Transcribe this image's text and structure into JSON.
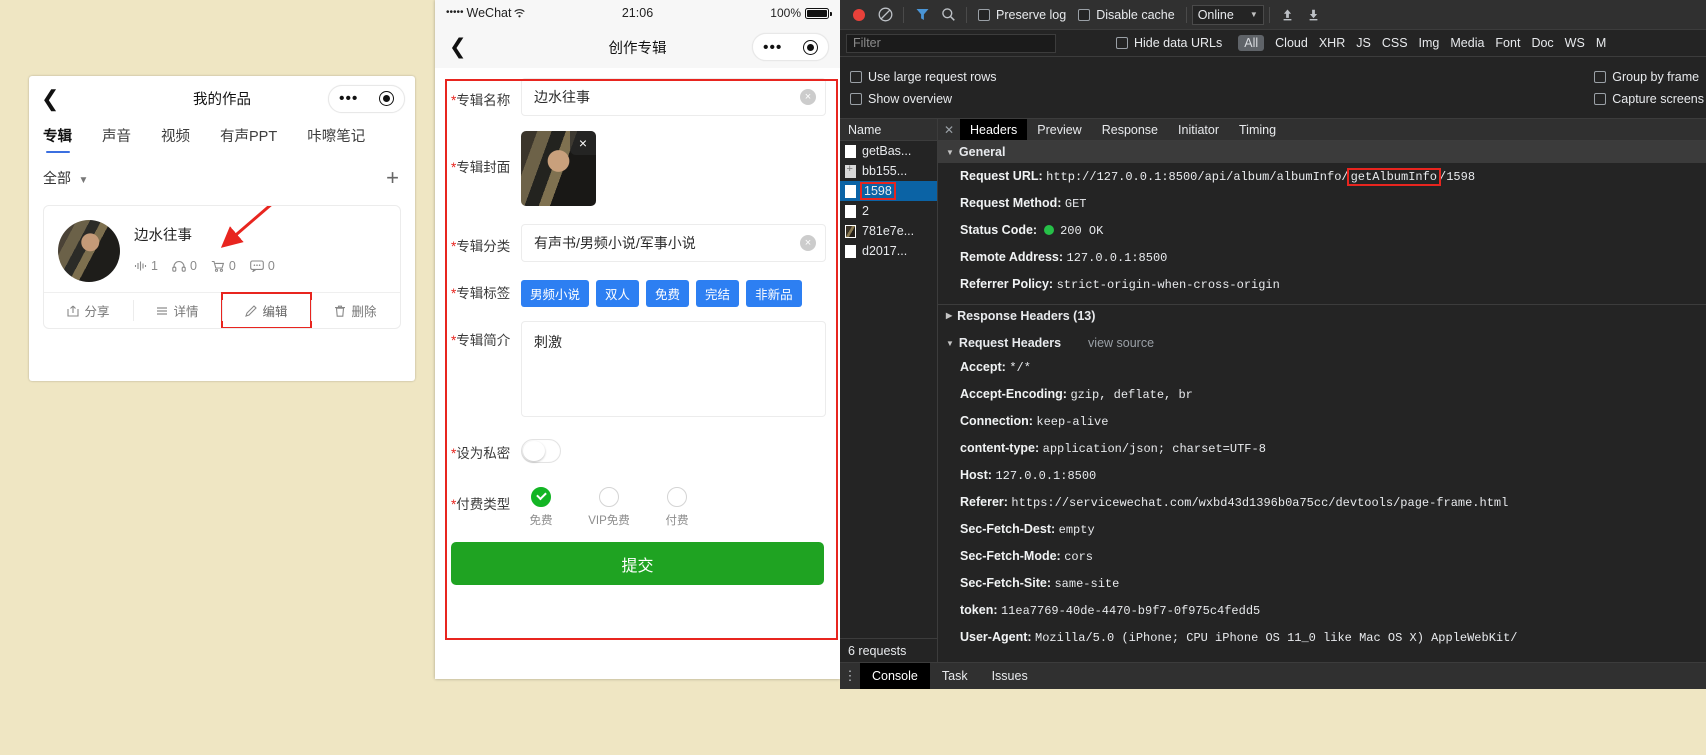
{
  "left_panel": {
    "nav": {
      "back_icon": "chevron-left-icon",
      "title": "我的作品",
      "capsule_dots": "•••",
      "capsule_circle": "target-icon"
    },
    "tabs": [
      {
        "label": "专辑",
        "active": true
      },
      {
        "label": "声音",
        "active": false
      },
      {
        "label": "视频",
        "active": false
      },
      {
        "label": "有声PPT",
        "active": false
      },
      {
        "label": "咔嚓笔记",
        "active": false
      }
    ],
    "filter": {
      "label": "全部",
      "chevron": "chevron-down-icon",
      "add": "+"
    },
    "card": {
      "title": "边水往事",
      "stats": [
        {
          "icon": "sound-wave-icon",
          "value": "1"
        },
        {
          "icon": "headphone-icon",
          "value": "0"
        },
        {
          "icon": "cart-icon",
          "value": "0"
        },
        {
          "icon": "comment-icon",
          "value": "0"
        }
      ],
      "actions": [
        {
          "icon": "share-icon",
          "label": "分享",
          "highlight": false
        },
        {
          "icon": "list-icon",
          "label": "详情",
          "highlight": false
        },
        {
          "icon": "pencil-icon",
          "label": "编辑",
          "highlight": true
        },
        {
          "icon": "trash-icon",
          "label": "删除",
          "highlight": false
        }
      ]
    }
  },
  "mid_phone": {
    "status": {
      "carrier": "WeChat",
      "signal_dots": "•••••",
      "wifi": "wifi-icon",
      "time": "21:06",
      "battery": "100%"
    },
    "nav": {
      "back_icon": "chevron-left-icon",
      "title": "创作专辑",
      "capsule_dots": "•••",
      "capsule_circle": "target-icon"
    },
    "form": {
      "name": {
        "label": "专辑名称",
        "value": "边水往事",
        "clear": "×"
      },
      "cover": {
        "label": "专辑封面",
        "remove": "×"
      },
      "category": {
        "label": "专辑分类",
        "value": "有声书/男频小说/军事小说",
        "clear": "×"
      },
      "tags": {
        "label": "专辑标签",
        "items": [
          "男频小说",
          "双人",
          "免费",
          "完结",
          "非新品"
        ]
      },
      "intro": {
        "label": "专辑简介",
        "value": "刺激"
      },
      "private": {
        "label": "设为私密",
        "on": false
      },
      "pay": {
        "label": "付费类型",
        "options": [
          {
            "label": "免费",
            "selected": true
          },
          {
            "label": "VIP免费",
            "selected": false
          },
          {
            "label": "付费",
            "selected": false
          }
        ]
      },
      "submit_label": "提交"
    }
  },
  "devtools": {
    "toolbar": {
      "record_icon": "record-dot-icon",
      "clear_icon": "clear-circle-icon",
      "filter_icon": "funnel-icon",
      "search_icon": "search-icon",
      "preserve_log": "Preserve log",
      "disable_cache": "Disable cache",
      "throttle": "Online",
      "throttle_caret": "chevron-down-icon",
      "upload_icon": "upload-arrow-icon",
      "download_icon": "download-arrow-icon"
    },
    "filterbar": {
      "placeholder": "Filter",
      "hide_data_urls": "Hide data URLs",
      "types": [
        "All",
        "Cloud",
        "XHR",
        "JS",
        "CSS",
        "Img",
        "Media",
        "Font",
        "Doc",
        "WS",
        "M"
      ]
    },
    "options": {
      "use_large_rows": "Use large request rows",
      "show_overview": "Show overview",
      "group_by_frame": "Group by frame",
      "capture_screens": "Capture screens"
    },
    "request_list": {
      "column": "Name",
      "rows": [
        {
          "name": "getBas...",
          "icon": "doc-icon",
          "selected": false,
          "highlight": false
        },
        {
          "name": "bb155...",
          "icon": "plus-doc-icon",
          "selected": false,
          "highlight": false
        },
        {
          "name": "1598",
          "icon": "doc-icon",
          "selected": true,
          "highlight": true
        },
        {
          "name": "2",
          "icon": "doc-icon",
          "selected": false,
          "highlight": false
        },
        {
          "name": "781e7e...",
          "icon": "image-icon",
          "selected": false,
          "highlight": false
        },
        {
          "name": "d2017...",
          "icon": "doc-icon",
          "selected": false,
          "highlight": false
        }
      ],
      "footer": "6 requests"
    },
    "detail": {
      "close_icon": "close-icon",
      "tabs": [
        {
          "label": "Headers",
          "active": true
        },
        {
          "label": "Preview",
          "active": false
        },
        {
          "label": "Response",
          "active": false
        },
        {
          "label": "Initiator",
          "active": false
        },
        {
          "label": "Timing",
          "active": false
        }
      ],
      "general": {
        "title": "General",
        "request_url_key": "Request URL:",
        "request_url_prefix": "http://127.0.0.1:8500/api/album/albumInfo/",
        "request_url_highlight": "getAlbumInfo",
        "request_url_suffix": "/1598",
        "rows": [
          {
            "key": "Request Method:",
            "value": "GET"
          },
          {
            "key": "Status Code:",
            "value": "200 OK",
            "status_dot": true
          },
          {
            "key": "Remote Address:",
            "value": "127.0.0.1:8500"
          },
          {
            "key": "Referrer Policy:",
            "value": "strict-origin-when-cross-origin"
          }
        ]
      },
      "response_headers_title": "Response Headers (13)",
      "request_headers_title": "Request Headers",
      "view_source": "view source",
      "request_headers": [
        {
          "key": "Accept:",
          "value": "*/*"
        },
        {
          "key": "Accept-Encoding:",
          "value": "gzip, deflate, br"
        },
        {
          "key": "Connection:",
          "value": "keep-alive"
        },
        {
          "key": "content-type:",
          "value": "application/json; charset=UTF-8"
        },
        {
          "key": "Host:",
          "value": "127.0.0.1:8500"
        },
        {
          "key": "Referer:",
          "value": "https://servicewechat.com/wxbd43d1396b0a75cc/devtools/page-frame.html"
        },
        {
          "key": "Sec-Fetch-Dest:",
          "value": "empty"
        },
        {
          "key": "Sec-Fetch-Mode:",
          "value": "cors"
        },
        {
          "key": "Sec-Fetch-Site:",
          "value": "same-site"
        },
        {
          "key": "token:",
          "value": "11ea7769-40de-4470-b9f7-0f975c4fedd5"
        },
        {
          "key": "User-Agent:",
          "value": "Mozilla/5.0 (iPhone; CPU iPhone OS 11_0 like Mac OS X) AppleWebKit/"
        }
      ]
    },
    "drawer": {
      "kebab": "more-options-icon",
      "tabs": [
        {
          "label": "Console",
          "active": true
        },
        {
          "label": "Task",
          "active": false
        },
        {
          "label": "Issues",
          "active": false
        }
      ]
    }
  },
  "colors": {
    "page_bg": "#efe6c3",
    "accent_red": "#e8251f",
    "tag_blue": "#2d7ff2",
    "submit_green": "#1fa322",
    "devtools_bg": "#242424",
    "selected_row": "#0b63a5"
  }
}
